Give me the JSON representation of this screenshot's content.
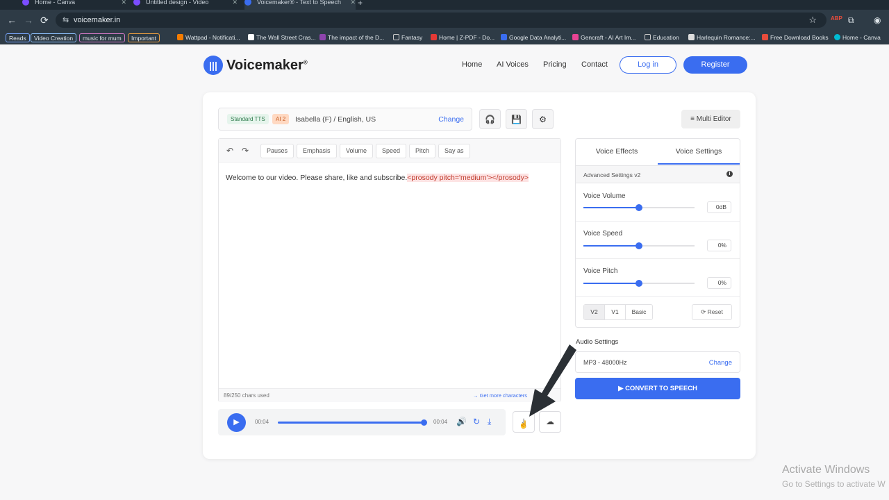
{
  "browser": {
    "tabs": [
      {
        "title": "Home - Canva"
      },
      {
        "title": "Untitled design - Video"
      },
      {
        "title": "Voicemaker® - Text to Speech"
      }
    ],
    "url": "voicemaker.in",
    "bookmarks": {
      "tags": [
        {
          "label": "Reads",
          "color": "#7aa7ff"
        },
        {
          "label": "Video Creation",
          "color": "#8fc2ff"
        },
        {
          "label": "music for mum",
          "color": "#d77ac9"
        },
        {
          "label": "Important",
          "color": "#f0a040"
        }
      ],
      "items": [
        {
          "label": "Wattpad - Notificati..."
        },
        {
          "label": "The Wall Street Cras..."
        },
        {
          "label": "The impact of the D..."
        },
        {
          "label": "Fantasy"
        },
        {
          "label": "Home | Z-PDF - Do..."
        },
        {
          "label": "Google Data Analyti..."
        },
        {
          "label": "Gencraft - AI Art Im..."
        },
        {
          "label": "Education"
        },
        {
          "label": "Harlequin Romance:..."
        },
        {
          "label": "Free Download Books"
        },
        {
          "label": "Home - Canva"
        }
      ]
    }
  },
  "site": {
    "logo_text": "Voicemaker",
    "logo_sup": "®",
    "nav": [
      "Home",
      "AI Voices",
      "Pricing",
      "Contact"
    ],
    "login_label": "Log in",
    "register_label": "Register",
    "brand_color": "#3a6df0"
  },
  "voice": {
    "badge_std": "Standard TTS",
    "badge_ai": "AI 2",
    "name": "Isabella (F) / English, US",
    "change_label": "Change"
  },
  "multi_editor_label": "Multi Editor",
  "editor": {
    "tools": [
      "Pauses",
      "Emphasis",
      "Volume",
      "Speed",
      "Pitch",
      "Say as"
    ],
    "text_plain": "Welcome to our video. Please share, like and subscribe.",
    "text_tag": "<prosody pitch='medium'></prosody>",
    "chars_used": "89/250 chars used",
    "more_chars": "→ Get more characters"
  },
  "player": {
    "time_current": "00:04",
    "time_total": "00:04",
    "progress": 1.0
  },
  "settings": {
    "tabs": [
      "Voice Effects",
      "Voice Settings"
    ],
    "active_tab": "Voice Settings",
    "advanced_label": "Advanced Settings v2",
    "sliders": [
      {
        "label": "Voice Volume",
        "value": "0dB",
        "level": 0.5
      },
      {
        "label": "Voice Speed",
        "value": "0%",
        "level": 0.5
      },
      {
        "label": "Voice Pitch",
        "value": "0%",
        "level": 0.5
      }
    ],
    "versions": [
      "V2",
      "V1",
      "Basic"
    ],
    "active_version": "V2",
    "reset_label": "Reset"
  },
  "audio": {
    "title": "Audio Settings",
    "format": "MP3 - 48000Hz",
    "change_label": "Change"
  },
  "convert_label": "CONVERT TO SPEECH",
  "windows": {
    "activate": "Activate Windows",
    "activate_sub": "Go to Settings to activate W"
  }
}
